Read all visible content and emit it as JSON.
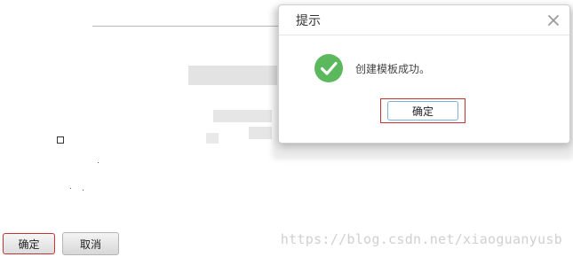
{
  "dialog": {
    "title": "提示",
    "message": "创建模板成功。",
    "ok_label": "确定",
    "success_color": "#5cb85c"
  },
  "footer": {
    "confirm_label": "确定",
    "cancel_label": "取消"
  },
  "watermark": "https://blog.csdn.net/xiaoguanyusb"
}
